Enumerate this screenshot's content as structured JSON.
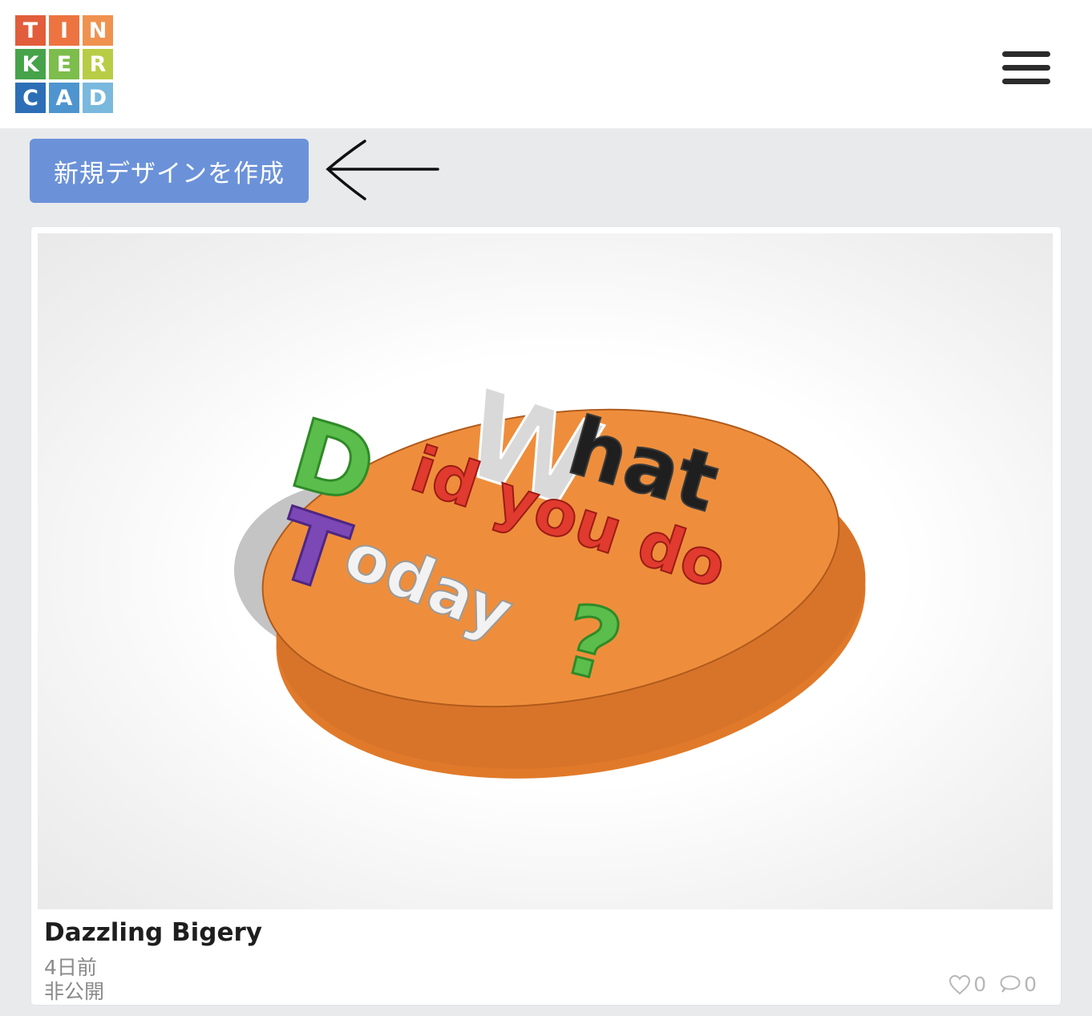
{
  "logo": {
    "tiles": [
      {
        "letter": "T",
        "color": "#e25d3b"
      },
      {
        "letter": "I",
        "color": "#ed7440"
      },
      {
        "letter": "N",
        "color": "#f0924f"
      },
      {
        "letter": "K",
        "color": "#46a34a"
      },
      {
        "letter": "E",
        "color": "#7dbd4c"
      },
      {
        "letter": "R",
        "color": "#b8cc45"
      },
      {
        "letter": "C",
        "color": "#2d6fb6"
      },
      {
        "letter": "A",
        "color": "#4e95cf"
      },
      {
        "letter": "D",
        "color": "#7ab8de"
      }
    ]
  },
  "header": {
    "menu_icon": "hamburger-menu-icon"
  },
  "actions": {
    "create_label": "新規デザインを作成",
    "accent": "#6b92d9"
  },
  "design": {
    "title": "Dazzling Bigery",
    "age": "4日前",
    "visibility": "非公開",
    "likes": "0",
    "comments": "0",
    "thumbnail_text": {
      "w": "W",
      "hat": "hat",
      "d": "D",
      "id_you_do": "id you do",
      "t": "T",
      "oday": "oday",
      "q": "?"
    }
  }
}
